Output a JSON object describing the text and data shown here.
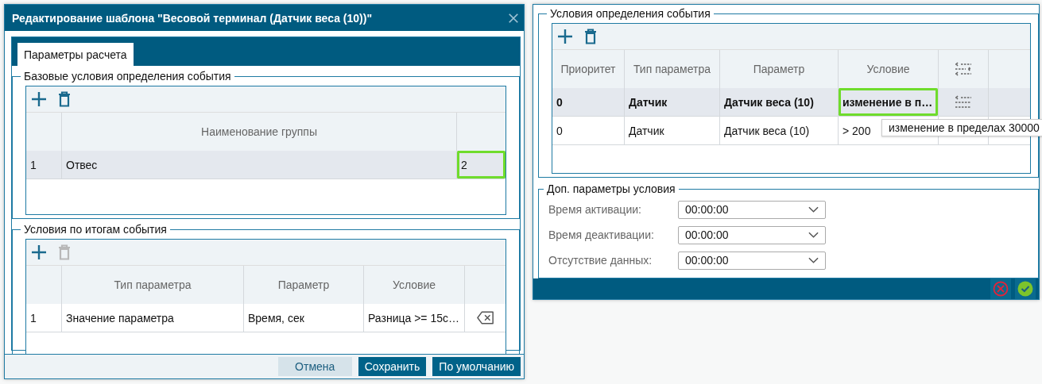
{
  "dialog": {
    "title": "Редактирование шаблона \"Весовой терминал (Датчик веса (10))\"",
    "tabs": [
      {
        "label": "Параметры расчета",
        "selected": true
      }
    ],
    "base_conditions": {
      "legend": "Базовые условия определения события",
      "add_enabled": true,
      "delete_enabled": true,
      "columns": [
        "",
        "Наименование группы",
        ""
      ],
      "rows": [
        {
          "cells": [
            "1",
            "Отвес",
            "2"
          ],
          "selected": true,
          "highlighted": [
            false,
            false,
            true
          ]
        }
      ]
    },
    "result_conditions": {
      "legend": "Условия по итогам события",
      "add_enabled": true,
      "delete_enabled": false,
      "columns": [
        "",
        "Тип параметра",
        "Параметр",
        "Условие",
        ""
      ],
      "rows": [
        {
          "cells": [
            "1",
            "Значение параметра",
            "Время, сек",
            "Разница >= 15с…"
          ],
          "selected": false
        }
      ]
    },
    "buttons": [
      {
        "label": "Отмена",
        "kind": "secondary"
      },
      {
        "label": "Сохранить",
        "kind": "primary"
      },
      {
        "label": "По умолчанию",
        "kind": "primary"
      }
    ]
  },
  "condition_panel": {
    "event_conditions": {
      "legend": "Условия определения события",
      "add_enabled": true,
      "delete_enabled": true,
      "columns": [
        "Приоритет",
        "Тип параметра",
        "Параметр",
        "Условие"
      ],
      "rows": [
        {
          "cells": [
            "0",
            "Датчик",
            "Датчик веса (10)",
            "изменение в п…"
          ],
          "selected": true,
          "highlighted": [
            false,
            false,
            false,
            true
          ]
        },
        {
          "cells": [
            "0",
            "Датчик",
            "Датчик веса (10)",
            "> 200"
          ],
          "selected": false,
          "tooltip": "изменение в пределах 30000"
        }
      ]
    },
    "extra_params": {
      "legend": "Доп. параметры условия",
      "fields": [
        {
          "label": "Время активации:",
          "value": "00:00:00"
        },
        {
          "label": "Время деактивации:",
          "value": "00:00:00"
        },
        {
          "label": "Отсутствие данных:",
          "value": "00:00:00"
        }
      ]
    }
  }
}
